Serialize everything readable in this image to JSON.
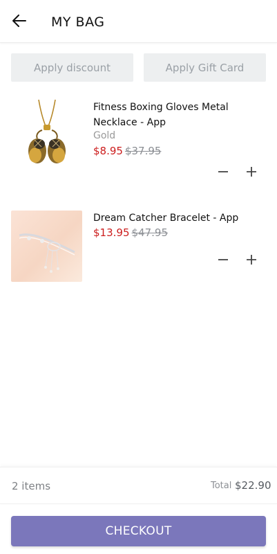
{
  "header": {
    "title": "MY BAG",
    "back_icon": "arrow-left-icon"
  },
  "actions": {
    "discount_label": "Apply discount",
    "gift_card_label": "Apply Gift Card"
  },
  "cart": {
    "items": [
      {
        "name": "Fitness Boxing Gloves Metal Necklace - App",
        "variant": "Gold",
        "price": "$8.95",
        "original_price": "$37.95"
      },
      {
        "name": "Dream Catcher Bracelet - App",
        "price": "$13.95",
        "original_price": "$47.95"
      }
    ]
  },
  "summary": {
    "item_count": "2 items",
    "total_label": "Total",
    "total_value": "$22.90"
  },
  "checkout_label": "CHECKOUT",
  "colors": {
    "accent": "#7b77bb",
    "sale_price": "#cc1d1d",
    "button_bg": "#edeff0"
  }
}
